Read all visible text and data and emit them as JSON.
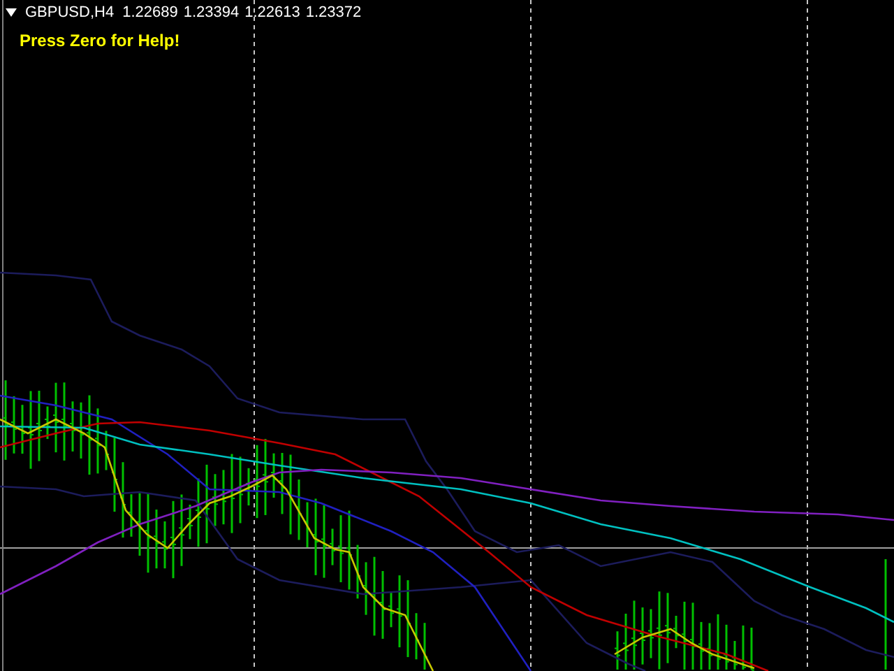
{
  "chart": {
    "symbol": "GBPUSD,H4",
    "quotes": [
      "1.22689",
      "1.23394",
      "1.22613",
      "1.23372"
    ],
    "help_text": "Press Zero for Help!"
  }
}
